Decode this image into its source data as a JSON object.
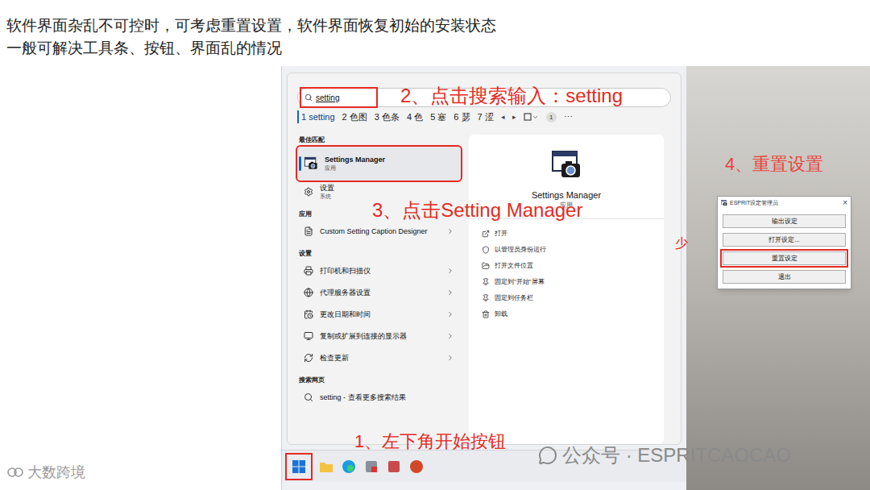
{
  "instructions": [
    "软件界面杂乱不可控时，可考虑重置设置，软件界面恢复初始的安装状态",
    "一般可解决工具条、按钮、界面乱的情况"
  ],
  "start_menu": {
    "search": {
      "value": "setting",
      "marked": true
    },
    "candidates": [
      {
        "label": "1 setting",
        "selected": true
      },
      {
        "label": "2 色图",
        "selected": false
      },
      {
        "label": "3 色条",
        "selected": false
      },
      {
        "label": "4 色",
        "selected": false
      },
      {
        "label": "5 塞",
        "selected": false
      },
      {
        "label": "6 瑟",
        "selected": false
      },
      {
        "label": "7 涩",
        "selected": false
      }
    ],
    "candidate_controls": [
      "◂",
      "▸"
    ],
    "badge": "1",
    "more": "⋯",
    "sections": [
      {
        "heading": "最佳匹配",
        "items": [
          {
            "title": "Settings Manager",
            "subtitle": "应用",
            "kind": "app",
            "selected": true,
            "marked": true,
            "chevron": false
          },
          {
            "title": "设置",
            "subtitle": "系统",
            "kind": "system",
            "selected": false,
            "marked": false,
            "chevron": false
          }
        ]
      },
      {
        "heading": "应用",
        "items": [
          {
            "title": "Custom Setting Caption Designer",
            "subtitle": "",
            "kind": "appdoc",
            "selected": false,
            "marked": false,
            "chevron": true
          }
        ]
      },
      {
        "heading": "设置",
        "items": [
          {
            "title": "打印机和扫描仪",
            "subtitle": "",
            "kind": "printer",
            "selected": false,
            "marked": false,
            "chevron": true
          },
          {
            "title": "代理服务器设置",
            "subtitle": "",
            "kind": "proxy",
            "selected": false,
            "marked": false,
            "chevron": true
          },
          {
            "title": "更改日期和时间",
            "subtitle": "",
            "kind": "datetime",
            "selected": false,
            "marked": false,
            "chevron": true
          },
          {
            "title": "复制或扩展到连接的显示器",
            "subtitle": "",
            "kind": "display",
            "selected": false,
            "marked": false,
            "chevron": true
          },
          {
            "title": "检查更新",
            "subtitle": "",
            "kind": "update",
            "selected": false,
            "marked": false,
            "chevron": true
          }
        ]
      },
      {
        "heading": "搜索网页",
        "items": [
          {
            "title": "setting - 查看更多搜索结果",
            "subtitle": "",
            "kind": "web",
            "selected": false,
            "marked": false,
            "chevron": false
          }
        ]
      }
    ],
    "preview": {
      "title": "Settings Manager",
      "subtitle": "应用",
      "actions": [
        {
          "label": "打开",
          "kind": "open"
        },
        {
          "label": "以管理员身份运行",
          "kind": "admin"
        },
        {
          "label": "打开文件位置",
          "kind": "folder"
        },
        {
          "label": "固定到\"开始\"屏幕",
          "kind": "pinstart"
        },
        {
          "label": "固定到任务栏",
          "kind": "pintaskbar"
        },
        {
          "label": "卸载",
          "kind": "uninstall"
        }
      ]
    }
  },
  "taskbar": {
    "start_marked": true
  },
  "dialog": {
    "title": "ESPRIT设定管理员",
    "close": "×",
    "buttons": [
      {
        "label": "输出设定",
        "marked": false
      },
      {
        "label": "打开设定...",
        "marked": false
      },
      {
        "label": "重置设定",
        "marked": true
      },
      {
        "label": "退出",
        "marked": false
      }
    ]
  },
  "annotations": {
    "step1": "1、左下角开始按钮",
    "step2": "2、点击搜索输入：setting",
    "step3": "3、点击Setting Manager",
    "step4": "4、重置设置",
    "fragment": "少"
  },
  "watermarks": {
    "wechat": "公众号 · ESPRITCAOCAO",
    "logo": "大数跨境"
  }
}
